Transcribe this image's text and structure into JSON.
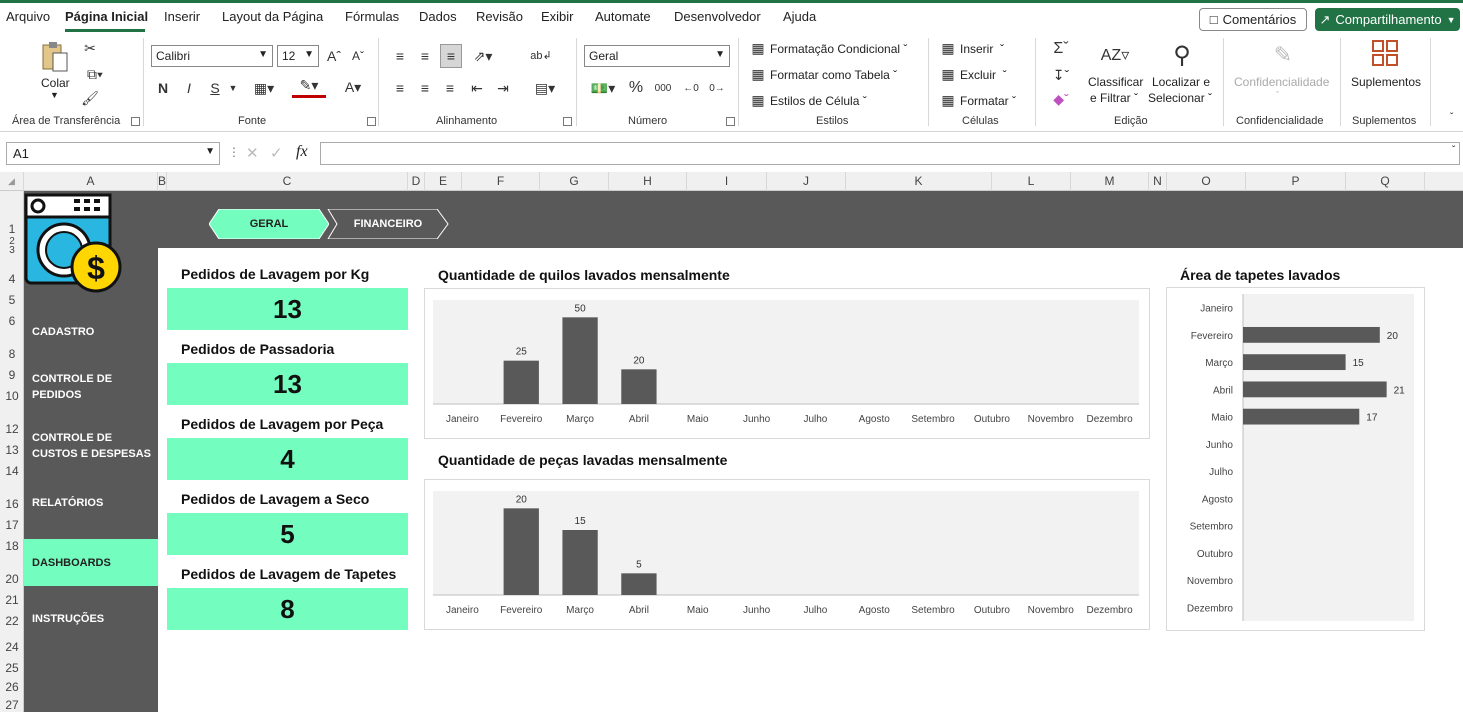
{
  "menu": {
    "items": [
      "Arquivo",
      "Página Inicial",
      "Inserir",
      "Layout da Página",
      "Fórmulas",
      "Dados",
      "Revisão",
      "Exibir",
      "Automate",
      "Desenvolvedor",
      "Ajuda"
    ],
    "comments": "Comentários",
    "share": "Compartilhamento"
  },
  "ribbon": {
    "clipboard": {
      "paste": "Colar",
      "label": "Área de Transferência"
    },
    "font": {
      "name": "Calibri",
      "size": "12",
      "bold": "N",
      "italic": "I",
      "underline": "S",
      "label": "Fonte"
    },
    "alignment": {
      "label": "Alinhamento"
    },
    "number": {
      "format": "Geral",
      "label": "Número"
    },
    "styles": {
      "conditional": "Formatação Condicional",
      "table": "Formatar como Tabela",
      "cell": "Estilos de Célula",
      "label": "Estilos"
    },
    "cells": {
      "insert": "Inserir",
      "delete": "Excluir",
      "format": "Formatar",
      "label": "Células"
    },
    "editing": {
      "sort_line1": "Classificar",
      "sort_line2": "e Filtrar",
      "find_line1": "Localizar e",
      "find_line2": "Selecionar",
      "label": "Edição"
    },
    "sensitivity": {
      "button": "Confidencialidade",
      "label": "Confidencialidade"
    },
    "addins": {
      "button": "Suplementos",
      "label": "Suplementos"
    }
  },
  "formula_bar": {
    "name_box": "A1",
    "fx": "fx",
    "value": ""
  },
  "columns": [
    "A",
    "B",
    "C",
    "D",
    "E",
    "F",
    "G",
    "H",
    "I",
    "J",
    "K",
    "L",
    "M",
    "N",
    "O",
    "P",
    "Q"
  ],
  "rows": [
    "1",
    "2",
    "3",
    "4",
    "5",
    "6",
    "8",
    "9",
    "10",
    "12",
    "13",
    "14",
    "16",
    "17",
    "18",
    "20",
    "21",
    "22",
    "24",
    "25",
    "26",
    "27"
  ],
  "dashboard": {
    "tabs": {
      "geral": "GERAL",
      "financeiro": "FINANCEIRO"
    },
    "sidebar": [
      {
        "line1": "CADASTRO",
        "line2": "",
        "active": false
      },
      {
        "line1": "CONTROLE DE",
        "line2": "PEDIDOS",
        "active": false
      },
      {
        "line1": "CONTROLE DE",
        "line2": "CUSTOS E DESPESAS",
        "active": false
      },
      {
        "line1": "RELATÓRIOS",
        "line2": "",
        "active": false
      },
      {
        "line1": "DASHBOARDS",
        "line2": "",
        "active": true
      },
      {
        "line1": "INSTRUÇÕES",
        "line2": "",
        "active": false
      }
    ],
    "kpis": [
      {
        "label": "Pedidos de Lavagem por Kg",
        "value": "13"
      },
      {
        "label": "Pedidos de Passadoria",
        "value": "13"
      },
      {
        "label": "Pedidos de Lavagem por Peça",
        "value": "4"
      },
      {
        "label": "Pedidos de Lavagem a Seco",
        "value": "5"
      },
      {
        "label": "Pedidos de Lavagem de Tapetes",
        "value": "8"
      }
    ],
    "colors": {
      "accent": "#73fdbe",
      "dark": "#595959",
      "bar": "#595959",
      "excel_green": "#217346"
    }
  },
  "chart_data": [
    {
      "type": "bar",
      "title": "Quantidade de quilos lavados mensalmente",
      "categories": [
        "Janeiro",
        "Fevereiro",
        "Março",
        "Abril",
        "Maio",
        "Junho",
        "Julho",
        "Agosto",
        "Setembro",
        "Outubro",
        "Novembro",
        "Dezembro"
      ],
      "values": [
        0,
        25,
        50,
        20,
        0,
        0,
        0,
        0,
        0,
        0,
        0,
        0
      ],
      "labels": [
        "",
        "25",
        "50",
        "20",
        "",
        "",
        "",
        "",
        "",
        "",
        "",
        ""
      ],
      "ylim": [
        0,
        60
      ],
      "grid": false
    },
    {
      "type": "bar",
      "title": "Quantidade de peças lavadas mensalmente",
      "categories": [
        "Janeiro",
        "Fevereiro",
        "Março",
        "Abril",
        "Maio",
        "Junho",
        "Julho",
        "Agosto",
        "Setembro",
        "Outubro",
        "Novembro",
        "Dezembro"
      ],
      "values": [
        0,
        20,
        15,
        5,
        0,
        0,
        0,
        0,
        0,
        0,
        0,
        0
      ],
      "labels": [
        "",
        "20",
        "15",
        "5",
        "",
        "",
        "",
        "",
        "",
        "",
        "",
        ""
      ],
      "ylim": [
        0,
        24
      ],
      "grid": false
    },
    {
      "type": "bar",
      "orientation": "horizontal",
      "title": "Área de tapetes lavados",
      "categories": [
        "Janeiro",
        "Fevereiro",
        "Março",
        "Abril",
        "Maio",
        "Junho",
        "Julho",
        "Agosto",
        "Setembro",
        "Outubro",
        "Novembro",
        "Dezembro"
      ],
      "values": [
        0,
        20,
        15,
        21,
        17,
        0,
        0,
        0,
        0,
        0,
        0,
        0
      ],
      "labels": [
        "",
        "20",
        "15",
        "21",
        "17",
        "",
        "",
        "",
        "",
        "",
        "",
        ""
      ],
      "xlim": [
        0,
        25
      ],
      "grid": false
    }
  ]
}
